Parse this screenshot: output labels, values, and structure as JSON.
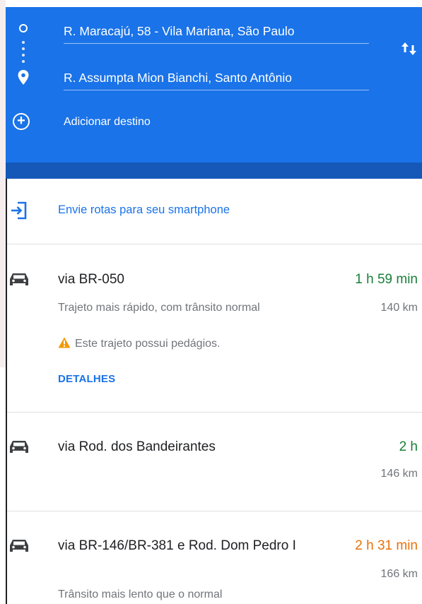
{
  "directions": {
    "origin_value": "R. Maracajú, 58 - Vila Mariana, São Paulo",
    "destination_value": "R. Assumpta Mion Bianchi, Santo Antônio",
    "add_destination_label": "Adicionar destino",
    "swap_icon": "swap-vertical-icon"
  },
  "send_to_phone": {
    "label": "Envie rotas para seu smartphone",
    "icon": "send-to-device-icon"
  },
  "routes": [
    {
      "name": "via BR-050",
      "duration": "1 h 59 min",
      "distance": "140 km",
      "description": "Trajeto mais rápido, com trânsito normal",
      "warning": "Este trajeto possui pedágios.",
      "details_label": "DETALHES",
      "duration_color": "#188038"
    },
    {
      "name": "via Rod. dos Bandeirantes",
      "duration": "2 h",
      "distance": "146 km",
      "duration_color": "#188038"
    },
    {
      "name": "via BR-146/BR-381 e Rod. Dom Pedro I",
      "duration": "2 h 31 min",
      "distance": "166 km",
      "description": "Trânsito mais lento que o normal",
      "duration_color": "#e8710a"
    }
  ],
  "colors": {
    "header_blue": "#1a73e8",
    "link_blue": "#1a73e8",
    "warning_orange": "#f29900"
  }
}
